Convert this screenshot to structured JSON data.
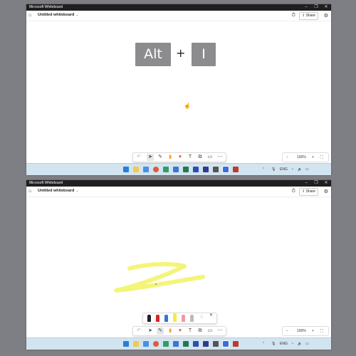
{
  "window1": {
    "title": "Microsoft Whiteboard",
    "controls": [
      "–",
      "❐",
      "✕"
    ],
    "whiteboard_name": "Untitled whiteboard",
    "chevron": "⌄",
    "share_label": "Share",
    "keys": {
      "key1": "Alt",
      "plus": "+",
      "key2": "I"
    },
    "cursor": "☝",
    "zoom": "100%",
    "zoom_out": "−",
    "zoom_in": "+",
    "fit": "⛶",
    "drawbar_icons": [
      "↶",
      "➤",
      "✎",
      "▮",
      "♥",
      "T",
      "⧉",
      "▭",
      "⋯"
    ]
  },
  "window2": {
    "title": "Microsoft Whiteboard",
    "controls": [
      "–",
      "❐",
      "✕"
    ],
    "whiteboard_name": "Untitled whiteboard",
    "chevron": "⌄",
    "share_label": "Share",
    "zoom": "100%",
    "zoom_out": "−",
    "zoom_in": "+",
    "fit": "⛶",
    "drawbar_icons": [
      "↶",
      "➤",
      "✎",
      "▮",
      "♥",
      "T",
      "⧉",
      "▭",
      "⋯"
    ],
    "pen_close": "✕",
    "lasso": "◌"
  },
  "taskbar": {
    "tray_up": "⌃",
    "mic": "🎙",
    "lang": "ENG",
    "wifi": "◔",
    "speaker": "🔈",
    "battery": "▭",
    "app_colors": [
      "#2a7fd4",
      "#f2c94c",
      "#4a90e2",
      "#e05a3a",
      "#2f9e6a",
      "#3f73d8",
      "#1f7a4e",
      "#2a4fb0",
      "#333a8c",
      "#555555",
      "#c0392b"
    ]
  },
  "colors": {
    "stroke": "#f4f47a",
    "key_bg": "#8c8c8f",
    "titlebar": "#1f1f1f"
  }
}
